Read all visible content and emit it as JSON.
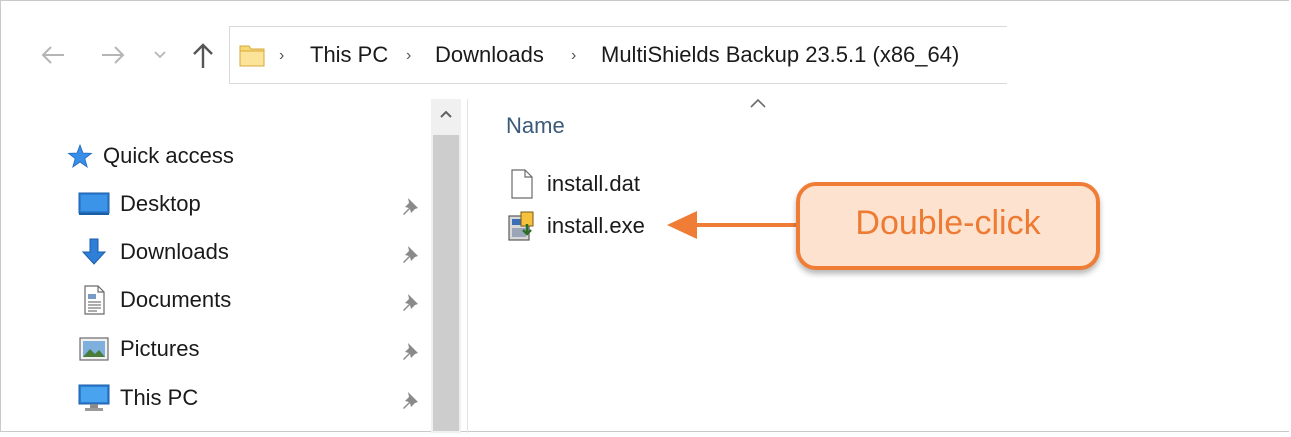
{
  "address": {
    "crumbs": [
      "This PC",
      "Downloads",
      "MultiShields Backup 23.5.1 (x86_64)"
    ],
    "separator": "›"
  },
  "nav": {
    "back_icon": "arrow-left-icon",
    "forward_icon": "arrow-right-icon",
    "recent_icon": "chevron-down-icon",
    "up_icon": "arrow-up-icon"
  },
  "sidebar": {
    "quick_access": {
      "label": "Quick access",
      "icon": "star-icon"
    },
    "items": [
      {
        "label": "Desktop",
        "icon": "desktop-icon",
        "pinned": true
      },
      {
        "label": "Downloads",
        "icon": "download-arrow-icon",
        "pinned": true
      },
      {
        "label": "Documents",
        "icon": "document-icon",
        "pinned": true
      },
      {
        "label": "Pictures",
        "icon": "picture-icon",
        "pinned": true
      },
      {
        "label": "This PC",
        "icon": "computer-icon",
        "pinned": true
      }
    ]
  },
  "file_list": {
    "column_name": "Name",
    "sort": "ascending",
    "files": [
      {
        "name": "install.dat",
        "icon": "blank-file-icon"
      },
      {
        "name": "install.exe",
        "icon": "installer-icon"
      }
    ]
  },
  "annotation": {
    "callout_text": "Double-click",
    "colors": {
      "fill": "#fde3cf",
      "stroke": "#ef7d36",
      "text": "#ee7b33"
    }
  },
  "colors": {
    "header_text": "#3b5a7a",
    "folder_yellow": "#f8d775",
    "accent_blue": "#2f7fd8"
  }
}
